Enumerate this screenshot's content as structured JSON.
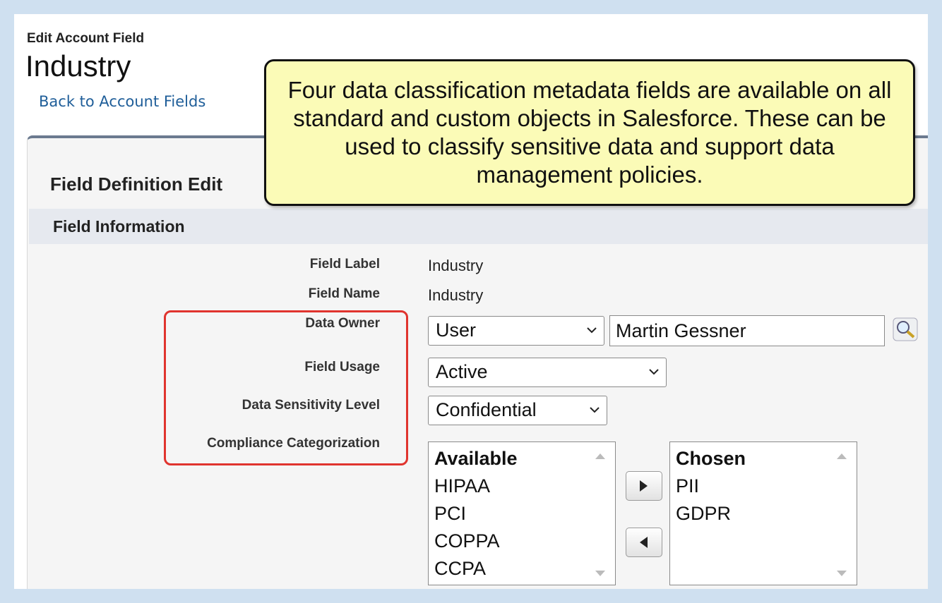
{
  "header": {
    "edit_type": "Edit Account Field",
    "title": "Industry",
    "back_link": "Back to Account Fields"
  },
  "panel": {
    "title": "Field Definition Edit",
    "section": "Field Information"
  },
  "fields": {
    "field_label": {
      "label": "Field Label",
      "value": "Industry"
    },
    "field_name": {
      "label": "Field Name",
      "value": "Industry"
    },
    "data_owner": {
      "label": "Data Owner",
      "type_value": "User",
      "value": "Martin Gessner"
    },
    "field_usage": {
      "label": "Field Usage",
      "value": "Active"
    },
    "data_sensitivity": {
      "label": "Data Sensitivity Level",
      "value": "Confidential"
    },
    "compliance": {
      "label": "Compliance Categorization",
      "available_header": "Available",
      "available": [
        "HIPAA",
        "PCI",
        "COPPA",
        "CCPA"
      ],
      "chosen_header": "Chosen",
      "chosen": [
        "PII",
        "GDPR"
      ]
    }
  },
  "callout": {
    "text": "Four data classification metadata fields are available on all standard and custom objects in Salesforce. These can be used to classify sensitive data and support data management policies."
  },
  "icons": {
    "lookup": "magnifier-lookup-icon",
    "chevron": "chevron-down-icon",
    "move_right": "arrow-right-icon",
    "move_left": "arrow-left-icon"
  },
  "colors": {
    "background": "#cfe0f0",
    "link": "#1f5e99",
    "highlight": "#e0342e",
    "callout": "#fbfbb7",
    "panel_border": "#6b7a8f"
  }
}
